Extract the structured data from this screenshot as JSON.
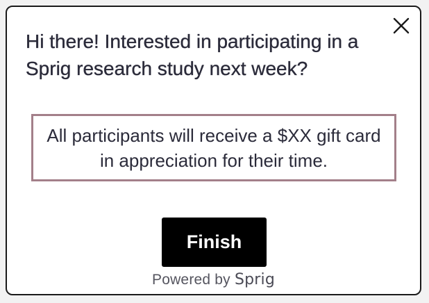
{
  "survey": {
    "question": "Hi there! Interested in participating in a Sprig research study next week?",
    "notice": "All participants will receive a $XX gift card in appreciation for their time.",
    "finish_label": "Finish",
    "powered_by_label": "Powered by",
    "brand_name": "Sprig",
    "close_icon": "close-icon"
  },
  "colors": {
    "card_border": "#1a1a1a",
    "notice_border": "#a37f89",
    "button_bg": "#000000",
    "button_text": "#ffffff",
    "text": "#2b2b3a"
  }
}
